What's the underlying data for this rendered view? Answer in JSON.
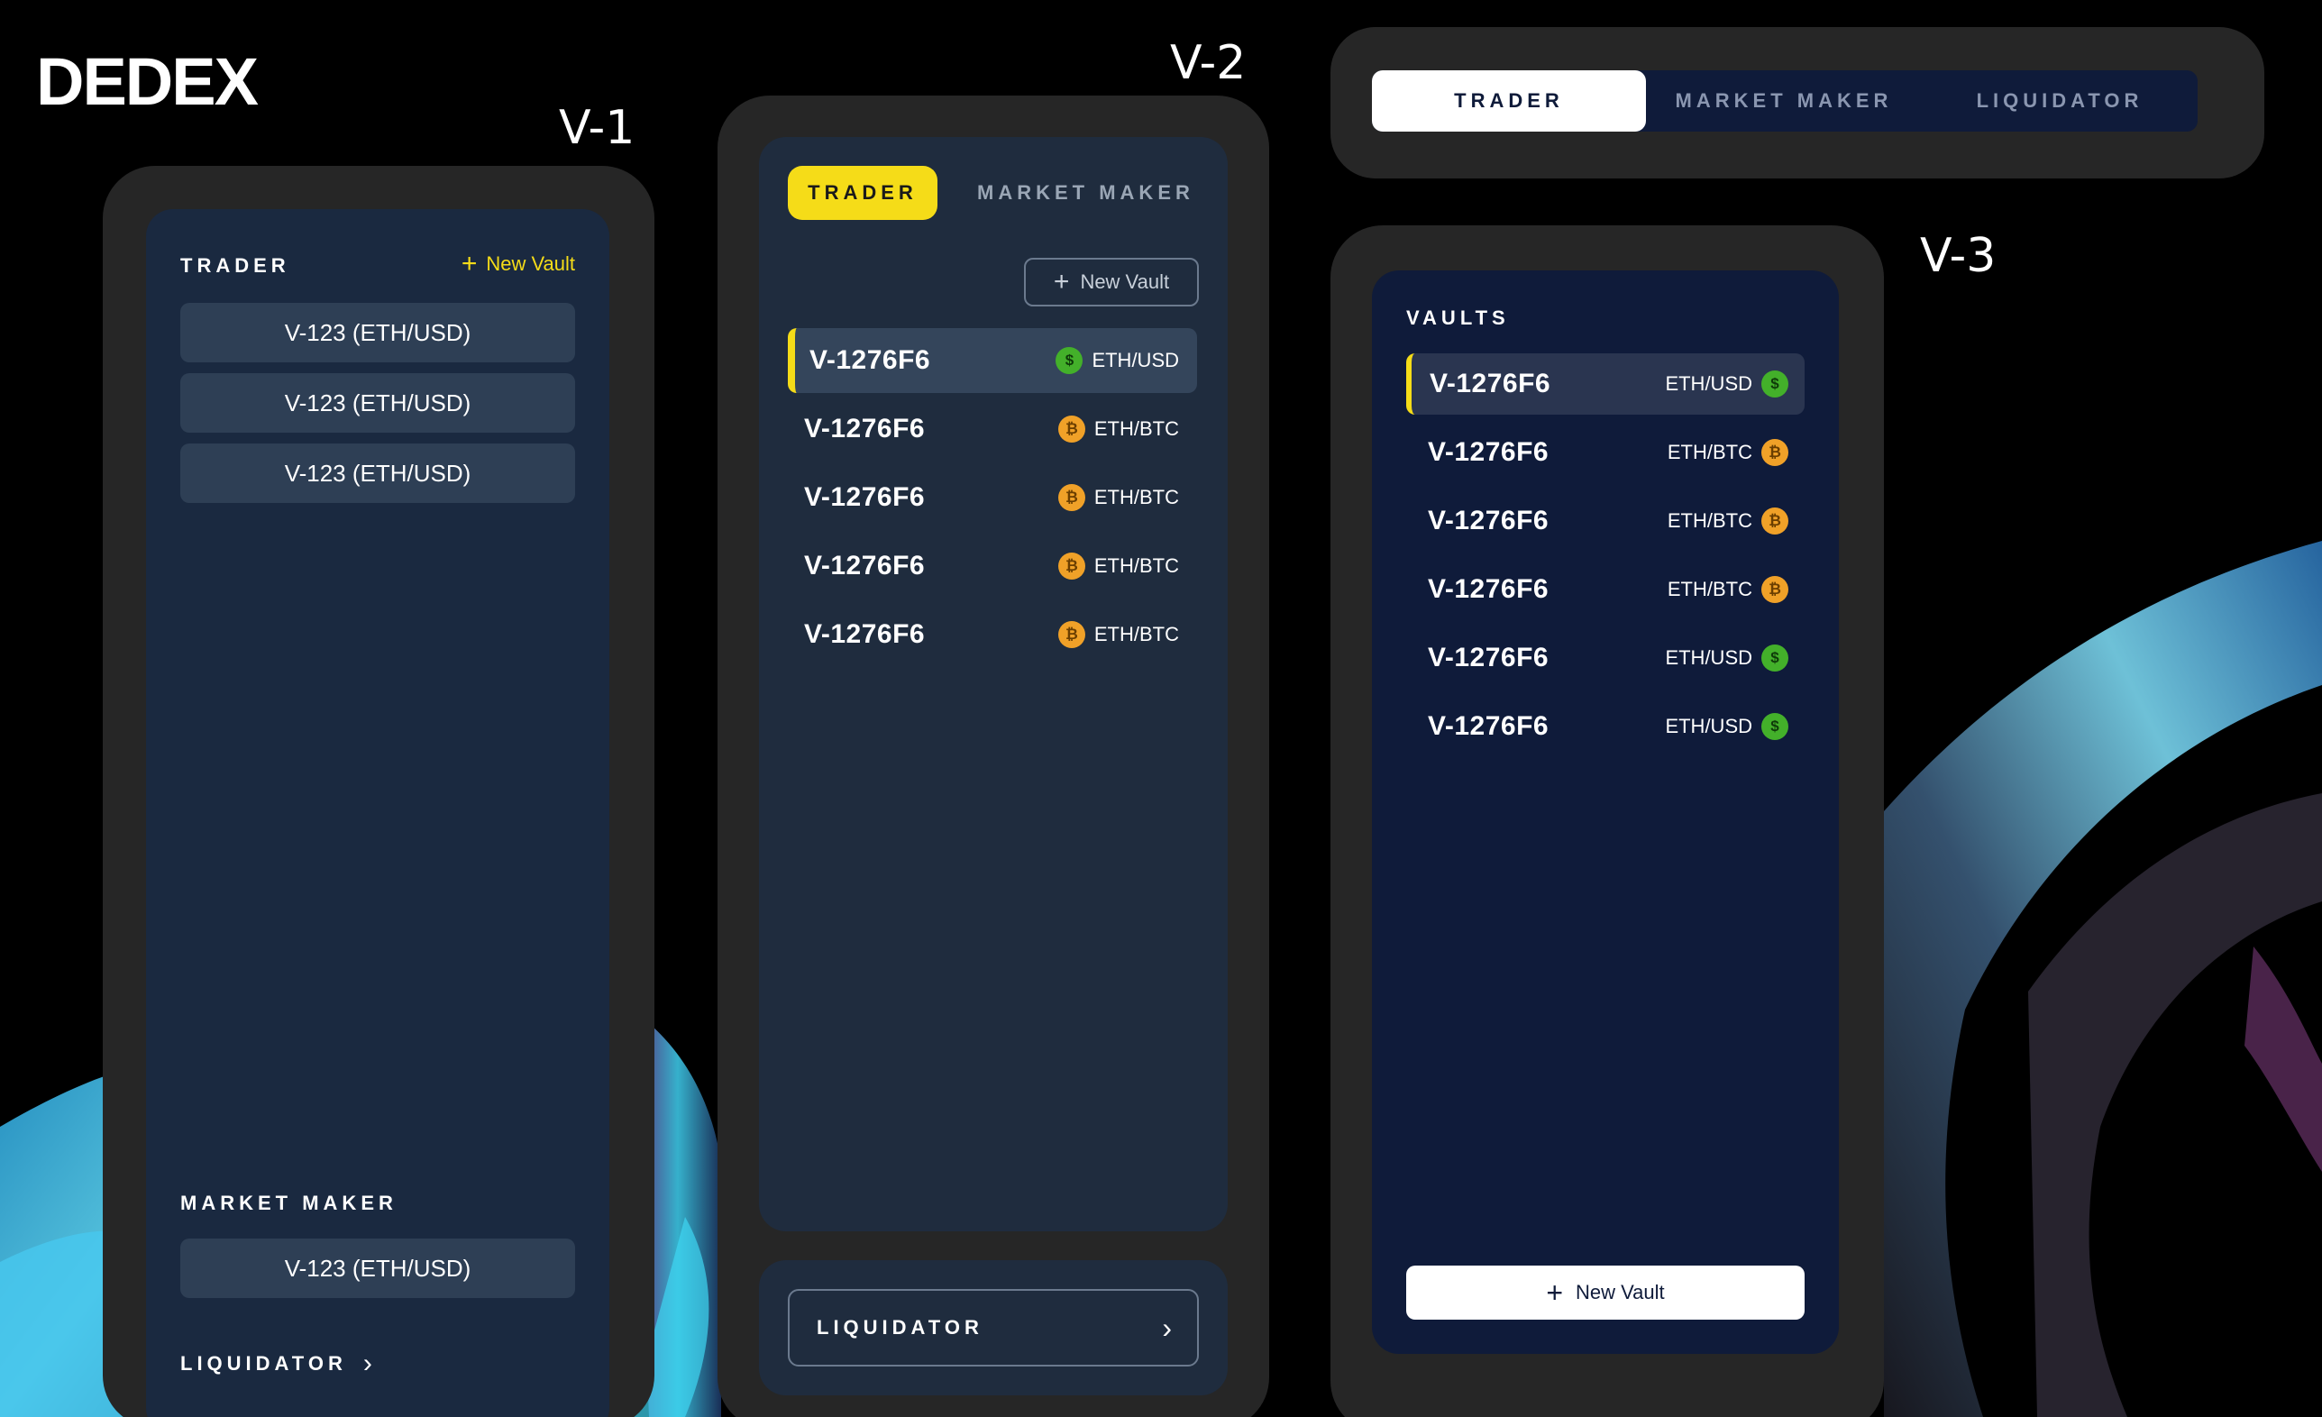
{
  "brand": "DEDEX",
  "version_labels": {
    "v1": "V-1",
    "v2": "V-2",
    "v3": "V-3"
  },
  "colors": {
    "accent_yellow": "#f5dc18",
    "usd_green": "#43b02a",
    "btc_orange": "#f0a128",
    "panel_v1": "#1a2940",
    "panel_v3": "#0f1b3a"
  },
  "v1": {
    "trader_label": "TRADER",
    "new_vault": "New Vault",
    "trader_items": [
      "V-123 (ETH/USD)",
      "V-123 (ETH/USD)",
      "V-123 (ETH/USD)"
    ],
    "market_maker_label": "MARKET MAKER",
    "market_maker_items": [
      "V-123 (ETH/USD)"
    ],
    "liquidator_label": "LIQUIDATOR",
    "chevron": "›"
  },
  "v2": {
    "tabs": [
      "TRADER",
      "MARKET MAKER"
    ],
    "new_vault": "New Vault",
    "vaults": [
      {
        "id": "V-1276F6",
        "pair": "ETH/USD",
        "coin": "$",
        "coin_icon": "dollar-coin-icon"
      },
      {
        "id": "V-1276F6",
        "pair": "ETH/BTC",
        "coin": "₿",
        "coin_icon": "bitcoin-coin-icon"
      },
      {
        "id": "V-1276F6",
        "pair": "ETH/BTC",
        "coin": "₿",
        "coin_icon": "bitcoin-coin-icon"
      },
      {
        "id": "V-1276F6",
        "pair": "ETH/BTC",
        "coin": "₿",
        "coin_icon": "bitcoin-coin-icon"
      },
      {
        "id": "V-1276F6",
        "pair": "ETH/BTC",
        "coin": "₿",
        "coin_icon": "bitcoin-coin-icon"
      }
    ],
    "liquidator_label": "LIQUIDATOR",
    "chevron": "›"
  },
  "v3": {
    "tabs": [
      "TRADER",
      "MARKET MAKER",
      "LIQUIDATOR"
    ],
    "vaults_label": "VAULTS",
    "vaults": [
      {
        "id": "V-1276F6",
        "pair": "ETH/USD",
        "coin": "$",
        "coin_icon": "dollar-coin-icon"
      },
      {
        "id": "V-1276F6",
        "pair": "ETH/BTC",
        "coin": "₿",
        "coin_icon": "bitcoin-coin-icon"
      },
      {
        "id": "V-1276F6",
        "pair": "ETH/BTC",
        "coin": "₿",
        "coin_icon": "bitcoin-coin-icon"
      },
      {
        "id": "V-1276F6",
        "pair": "ETH/BTC",
        "coin": "₿",
        "coin_icon": "bitcoin-coin-icon"
      },
      {
        "id": "V-1276F6",
        "pair": "ETH/USD",
        "coin": "$",
        "coin_icon": "dollar-coin-icon"
      },
      {
        "id": "V-1276F6",
        "pair": "ETH/USD",
        "coin": "$",
        "coin_icon": "dollar-coin-icon"
      }
    ],
    "new_vault": "New Vault"
  }
}
